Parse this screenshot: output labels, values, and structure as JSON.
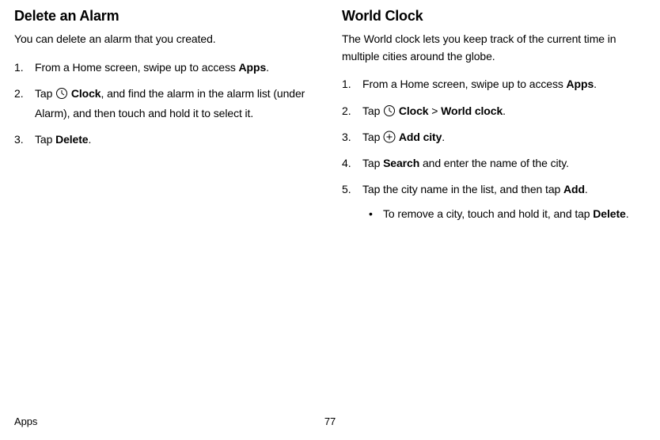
{
  "left": {
    "heading": "Delete an Alarm",
    "intro": "You can delete an alarm that you created.",
    "steps": {
      "s1a": "From a Home screen, swipe up to access ",
      "s1b": "Apps",
      "s1c": ".",
      "s2a": "Tap ",
      "s2b": "Clock",
      "s2c": ", and find the alarm in the alarm list (under Alarm), and then touch and hold it to select it.",
      "s3a": "Tap ",
      "s3b": "Delete",
      "s3c": "."
    }
  },
  "right": {
    "heading": "World Clock",
    "intro": "The World clock lets you keep track of the current time in multiple cities around the globe.",
    "steps": {
      "s1a": "From a Home screen, swipe up to access ",
      "s1b": "Apps",
      "s1c": ".",
      "s2a": "Tap ",
      "s2b": "Clock",
      "s2c": " > ",
      "s2d": "World clock",
      "s2e": ".",
      "s3a": "Tap ",
      "s3b": "Add city",
      "s3c": ".",
      "s4a": "Tap ",
      "s4b": "Search",
      "s4c": " and enter the name of the city.",
      "s5a": "Tap the city name in the list, and then tap ",
      "s5b": "Add",
      "s5c": ".",
      "b1a": "To remove a city, touch and hold it, and tap ",
      "b1b": "Delete",
      "b1c": "."
    }
  },
  "footer": {
    "section": "Apps",
    "page": "77"
  }
}
